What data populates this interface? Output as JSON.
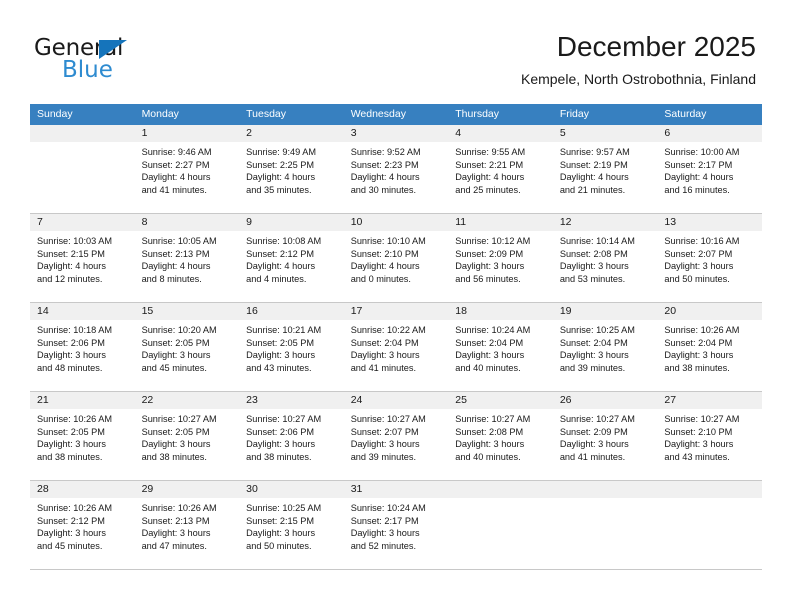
{
  "brand": {
    "name_top": "General",
    "name_bottom": "Blue",
    "triangle_icon": "triangle-icon",
    "accent_color": "#1574bb",
    "blue_text_color": "#2e8bd0"
  },
  "header": {
    "title": "December 2025",
    "subtitle": "Kempele, North Ostrobothnia, Finland"
  },
  "calendar": {
    "header_background": "#3780c0",
    "date_band_background": "#f0f0f0",
    "day_names": [
      "Sunday",
      "Monday",
      "Tuesday",
      "Wednesday",
      "Thursday",
      "Friday",
      "Saturday"
    ],
    "weeks": [
      [
        {
          "date": "",
          "lines": []
        },
        {
          "date": "1",
          "lines": [
            "Sunrise: 9:46 AM",
            "Sunset: 2:27 PM",
            "Daylight: 4 hours",
            "and 41 minutes."
          ]
        },
        {
          "date": "2",
          "lines": [
            "Sunrise: 9:49 AM",
            "Sunset: 2:25 PM",
            "Daylight: 4 hours",
            "and 35 minutes."
          ]
        },
        {
          "date": "3",
          "lines": [
            "Sunrise: 9:52 AM",
            "Sunset: 2:23 PM",
            "Daylight: 4 hours",
            "and 30 minutes."
          ]
        },
        {
          "date": "4",
          "lines": [
            "Sunrise: 9:55 AM",
            "Sunset: 2:21 PM",
            "Daylight: 4 hours",
            "and 25 minutes."
          ]
        },
        {
          "date": "5",
          "lines": [
            "Sunrise: 9:57 AM",
            "Sunset: 2:19 PM",
            "Daylight: 4 hours",
            "and 21 minutes."
          ]
        },
        {
          "date": "6",
          "lines": [
            "Sunrise: 10:00 AM",
            "Sunset: 2:17 PM",
            "Daylight: 4 hours",
            "and 16 minutes."
          ]
        }
      ],
      [
        {
          "date": "7",
          "lines": [
            "Sunrise: 10:03 AM",
            "Sunset: 2:15 PM",
            "Daylight: 4 hours",
            "and 12 minutes."
          ]
        },
        {
          "date": "8",
          "lines": [
            "Sunrise: 10:05 AM",
            "Sunset: 2:13 PM",
            "Daylight: 4 hours",
            "and 8 minutes."
          ]
        },
        {
          "date": "9",
          "lines": [
            "Sunrise: 10:08 AM",
            "Sunset: 2:12 PM",
            "Daylight: 4 hours",
            "and 4 minutes."
          ]
        },
        {
          "date": "10",
          "lines": [
            "Sunrise: 10:10 AM",
            "Sunset: 2:10 PM",
            "Daylight: 4 hours",
            "and 0 minutes."
          ]
        },
        {
          "date": "11",
          "lines": [
            "Sunrise: 10:12 AM",
            "Sunset: 2:09 PM",
            "Daylight: 3 hours",
            "and 56 minutes."
          ]
        },
        {
          "date": "12",
          "lines": [
            "Sunrise: 10:14 AM",
            "Sunset: 2:08 PM",
            "Daylight: 3 hours",
            "and 53 minutes."
          ]
        },
        {
          "date": "13",
          "lines": [
            "Sunrise: 10:16 AM",
            "Sunset: 2:07 PM",
            "Daylight: 3 hours",
            "and 50 minutes."
          ]
        }
      ],
      [
        {
          "date": "14",
          "lines": [
            "Sunrise: 10:18 AM",
            "Sunset: 2:06 PM",
            "Daylight: 3 hours",
            "and 48 minutes."
          ]
        },
        {
          "date": "15",
          "lines": [
            "Sunrise: 10:20 AM",
            "Sunset: 2:05 PM",
            "Daylight: 3 hours",
            "and 45 minutes."
          ]
        },
        {
          "date": "16",
          "lines": [
            "Sunrise: 10:21 AM",
            "Sunset: 2:05 PM",
            "Daylight: 3 hours",
            "and 43 minutes."
          ]
        },
        {
          "date": "17",
          "lines": [
            "Sunrise: 10:22 AM",
            "Sunset: 2:04 PM",
            "Daylight: 3 hours",
            "and 41 minutes."
          ]
        },
        {
          "date": "18",
          "lines": [
            "Sunrise: 10:24 AM",
            "Sunset: 2:04 PM",
            "Daylight: 3 hours",
            "and 40 minutes."
          ]
        },
        {
          "date": "19",
          "lines": [
            "Sunrise: 10:25 AM",
            "Sunset: 2:04 PM",
            "Daylight: 3 hours",
            "and 39 minutes."
          ]
        },
        {
          "date": "20",
          "lines": [
            "Sunrise: 10:26 AM",
            "Sunset: 2:04 PM",
            "Daylight: 3 hours",
            "and 38 minutes."
          ]
        }
      ],
      [
        {
          "date": "21",
          "lines": [
            "Sunrise: 10:26 AM",
            "Sunset: 2:05 PM",
            "Daylight: 3 hours",
            "and 38 minutes."
          ]
        },
        {
          "date": "22",
          "lines": [
            "Sunrise: 10:27 AM",
            "Sunset: 2:05 PM",
            "Daylight: 3 hours",
            "and 38 minutes."
          ]
        },
        {
          "date": "23",
          "lines": [
            "Sunrise: 10:27 AM",
            "Sunset: 2:06 PM",
            "Daylight: 3 hours",
            "and 38 minutes."
          ]
        },
        {
          "date": "24",
          "lines": [
            "Sunrise: 10:27 AM",
            "Sunset: 2:07 PM",
            "Daylight: 3 hours",
            "and 39 minutes."
          ]
        },
        {
          "date": "25",
          "lines": [
            "Sunrise: 10:27 AM",
            "Sunset: 2:08 PM",
            "Daylight: 3 hours",
            "and 40 minutes."
          ]
        },
        {
          "date": "26",
          "lines": [
            "Sunrise: 10:27 AM",
            "Sunset: 2:09 PM",
            "Daylight: 3 hours",
            "and 41 minutes."
          ]
        },
        {
          "date": "27",
          "lines": [
            "Sunrise: 10:27 AM",
            "Sunset: 2:10 PM",
            "Daylight: 3 hours",
            "and 43 minutes."
          ]
        }
      ],
      [
        {
          "date": "28",
          "lines": [
            "Sunrise: 10:26 AM",
            "Sunset: 2:12 PM",
            "Daylight: 3 hours",
            "and 45 minutes."
          ]
        },
        {
          "date": "29",
          "lines": [
            "Sunrise: 10:26 AM",
            "Sunset: 2:13 PM",
            "Daylight: 3 hours",
            "and 47 minutes."
          ]
        },
        {
          "date": "30",
          "lines": [
            "Sunrise: 10:25 AM",
            "Sunset: 2:15 PM",
            "Daylight: 3 hours",
            "and 50 minutes."
          ]
        },
        {
          "date": "31",
          "lines": [
            "Sunrise: 10:24 AM",
            "Sunset: 2:17 PM",
            "Daylight: 3 hours",
            "and 52 minutes."
          ]
        },
        {
          "date": "",
          "lines": []
        },
        {
          "date": "",
          "lines": []
        },
        {
          "date": "",
          "lines": []
        }
      ]
    ]
  }
}
